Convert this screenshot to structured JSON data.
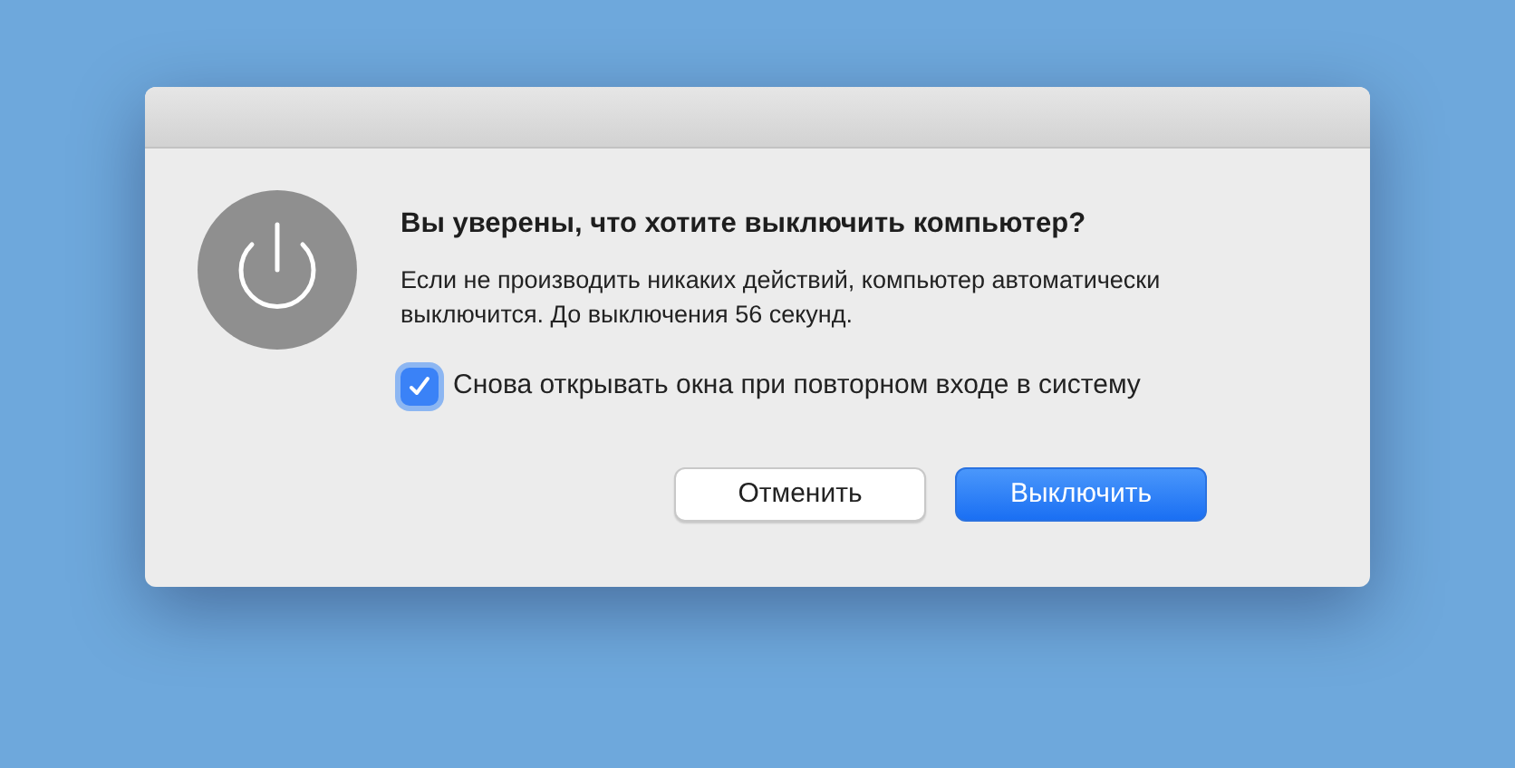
{
  "dialog": {
    "heading": "Вы уверены, что хотите выключить компьютер?",
    "message": "Если не производить никаких действий, компьютер автоматически выключится. До выключения 56 секунд.",
    "checkbox": {
      "label": "Снова открывать окна при повторном входе в систему",
      "checked": true
    },
    "buttons": [
      {
        "label": "Отменить",
        "kind": "secondary"
      },
      {
        "label": "Выключить",
        "kind": "primary"
      }
    ]
  }
}
